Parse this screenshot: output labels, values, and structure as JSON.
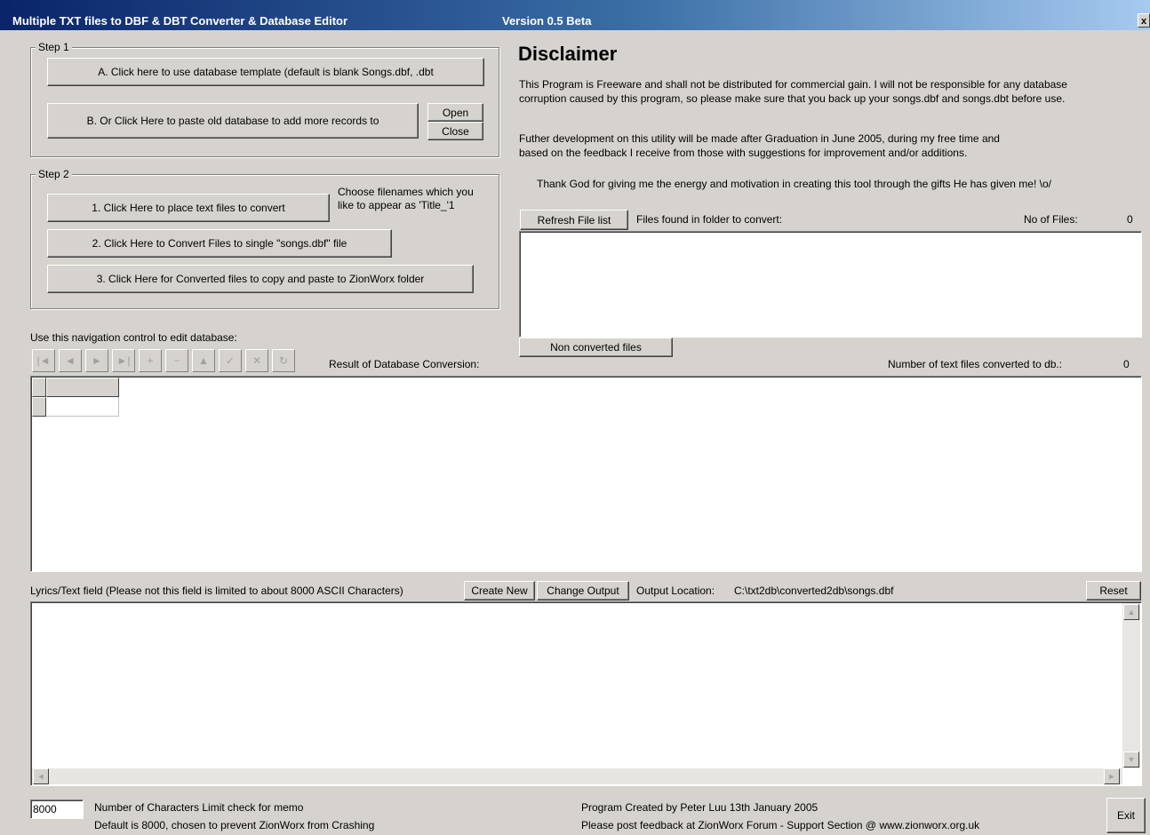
{
  "window": {
    "title": "Multiple TXT files to DBF & DBT Converter & Database Editor",
    "version": "Version 0.5 Beta",
    "close_glyph": "x"
  },
  "step1": {
    "label": "Step 1",
    "btn_a": "A. Click here to use database template (default is blank Songs.dbf,   .dbt",
    "btn_b": "B. Or Click Here to paste old database to add more records to",
    "open": "Open",
    "close": "Close"
  },
  "step2": {
    "label": "Step 2",
    "btn_1": "1. Click Here to place text files to convert",
    "hint_line1": "Choose filenames which you",
    "hint_line2": "like to appear as 'Title_'1",
    "btn_2": "2. Click Here to Convert Files to single \"songs.dbf\" file",
    "btn_3": "3. Click Here for Converted files to copy and paste to ZionWorx folder"
  },
  "disclaimer": {
    "heading": "Disclaimer",
    "p1_line1": "This Program is Freeware and shall not be distributed for commercial gain. I will not be responsible for any database",
    "p1_line2": "corruption caused by this program, so please make sure that you back up your songs.dbf and songs.dbt before use.",
    "p2_line1": "Futher development on this utility will be made after Graduation in June 2005, during my free time and",
    "p2_line2": "based on the feedback I receive from those with suggestions for improvement and/or additions.",
    "p3": "Thank God for giving me the energy and motivation in creating this tool through the gifts He has given me! \\o/"
  },
  "files": {
    "refresh": "Refresh File list",
    "found_label": "Files found in folder to convert:",
    "count_label": "No of Files:",
    "count": "0",
    "non_converted": "Non converted  files"
  },
  "nav": {
    "label": "Use this navigation control to edit database:",
    "buttons": [
      "|◄",
      "◄",
      "►",
      "►|",
      "+",
      "−",
      "▲",
      "✓",
      "✕",
      "↻"
    ]
  },
  "result": {
    "label": "Result of Database Conversion:",
    "converted_label": "Number of text files converted to db.:",
    "converted_count": "0"
  },
  "lyrics": {
    "label": "Lyrics/Text field (Please not this field is limited to about 8000 ASCII Characters)",
    "create_new": "Create New",
    "change_output": "Change Output",
    "output_label": "Output Location:",
    "output_path": "C:\\txt2db\\converted2db\\songs.dbf",
    "reset": "Reset"
  },
  "footer": {
    "limit_value": "8000",
    "limit_line1": "Number of Characters Limit check for memo",
    "limit_line2": "Default is 8000, chosen to prevent ZionWorx from Crashing",
    "credit_line1": "Program Created by Peter Luu 13th January 2005",
    "credit_line2": "Please post feedback at ZionWorx Forum - Support Section @ www.zionworx.org.uk",
    "exit": "Exit"
  }
}
